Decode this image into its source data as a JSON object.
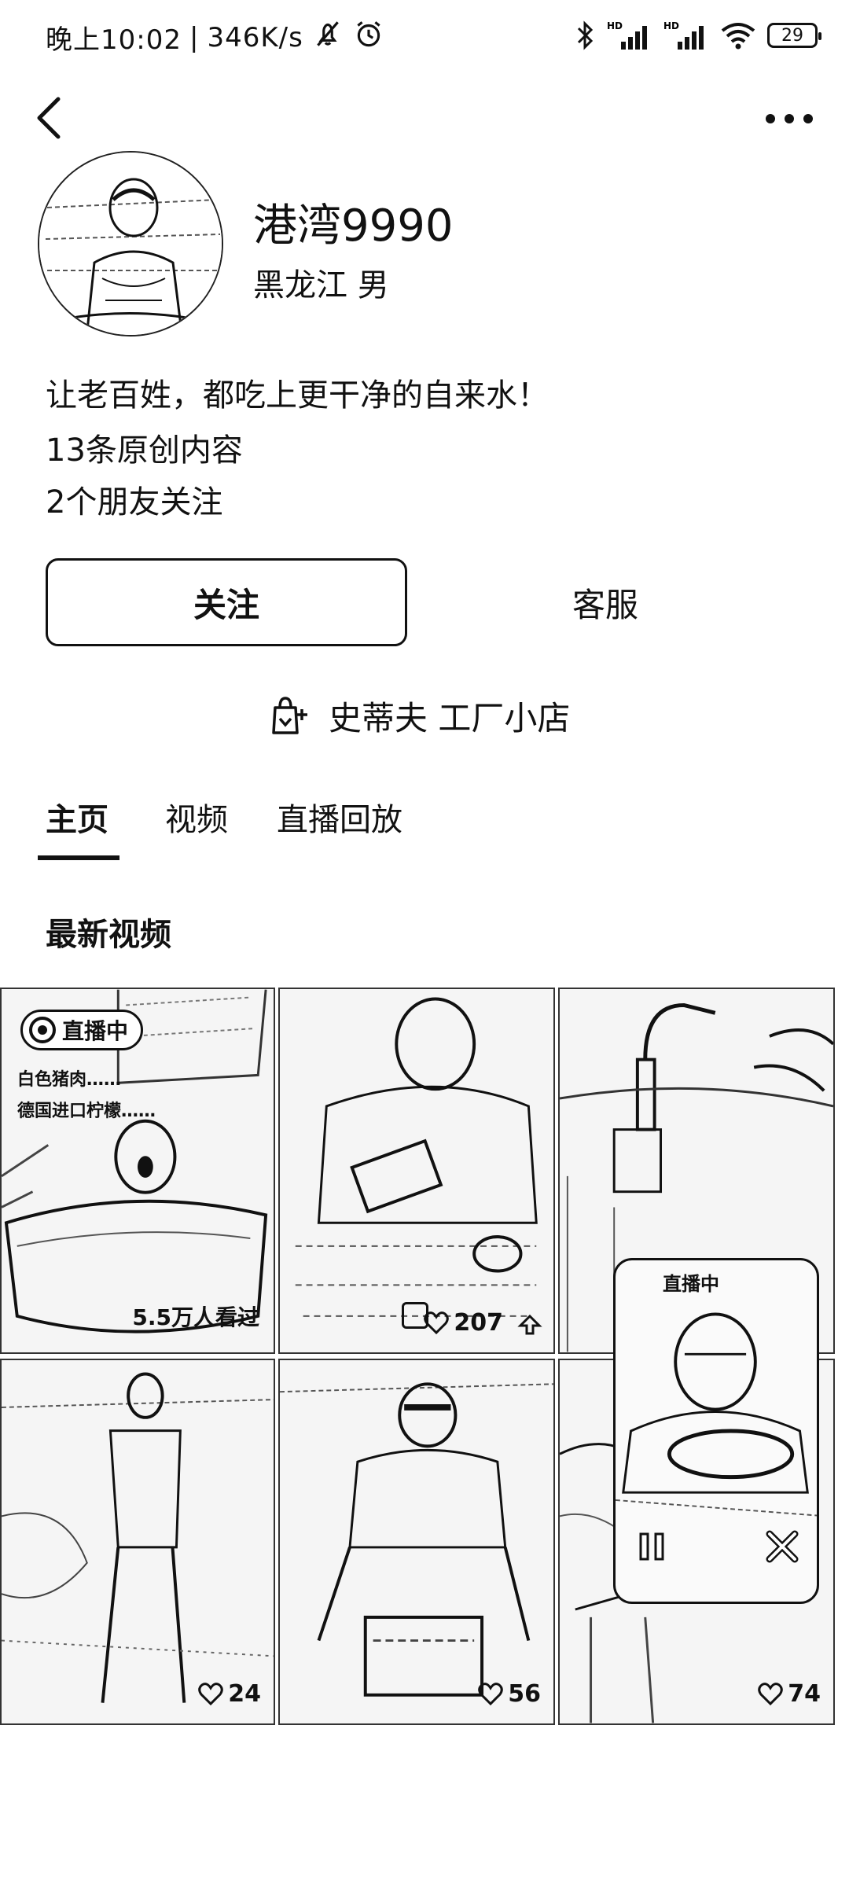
{
  "status_bar": {
    "time": "晚上10:02",
    "speed": "346K/s",
    "battery": "29"
  },
  "profile": {
    "name": "港湾9990",
    "region_gender": "黑龙江 男",
    "bio_lines": [
      "让老百姓，都吃上更干净的自来水！",
      "13条原创内容",
      "2个朋友关注"
    ]
  },
  "actions": {
    "follow": "关注",
    "service": "客服"
  },
  "shop": {
    "label": "史蒂夫 工厂小店"
  },
  "tabs": [
    "主页",
    "视频",
    "直播回放"
  ],
  "section_title": "最新视频",
  "videos": [
    {
      "badge": "直播中",
      "lines": [
        "白色猪肉……",
        "德国进口柠檬……"
      ],
      "stat": "5.5万人看过"
    },
    {
      "likes": "207"
    },
    {},
    {
      "likes": "24"
    },
    {
      "likes": "56"
    },
    {
      "likes": "74"
    }
  ],
  "live_window": {
    "title": "直播中"
  }
}
